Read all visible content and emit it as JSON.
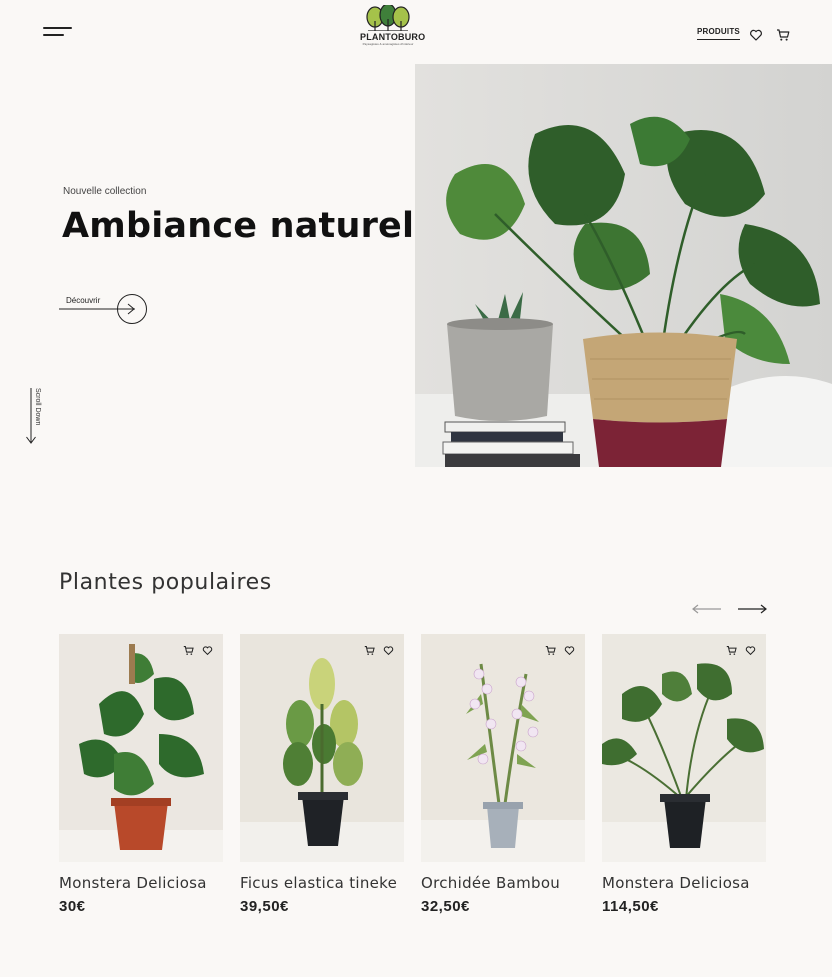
{
  "header": {
    "logo_name": "PLANTOBURO",
    "logo_tagline": "Paysagistes & aménagistes d'intérieur",
    "nav_products": "PRODUITS"
  },
  "hero": {
    "eyebrow": "Nouvelle collection",
    "title": "Ambiance naturelle",
    "cta_label": "Découvrir",
    "scroll_label": "Scroll Down"
  },
  "popular": {
    "title": "Plantes populaires",
    "products": [
      {
        "name": "Monstera Deliciosa",
        "price": "30€"
      },
      {
        "name": "Ficus elastica tineke",
        "price": "39,50€"
      },
      {
        "name": "Orchidée Bambou",
        "price": "32,50€"
      },
      {
        "name": "Monstera Deliciosa",
        "price": "114,50€"
      }
    ]
  },
  "icons": [
    "menu-icon",
    "heart-icon",
    "cart-icon",
    "arrow-right-icon",
    "arrow-down-icon",
    "arrow-left-icon"
  ],
  "colors": {
    "background": "#faf8f6",
    "text": "#222222",
    "leaf": "#2f6b2a"
  }
}
